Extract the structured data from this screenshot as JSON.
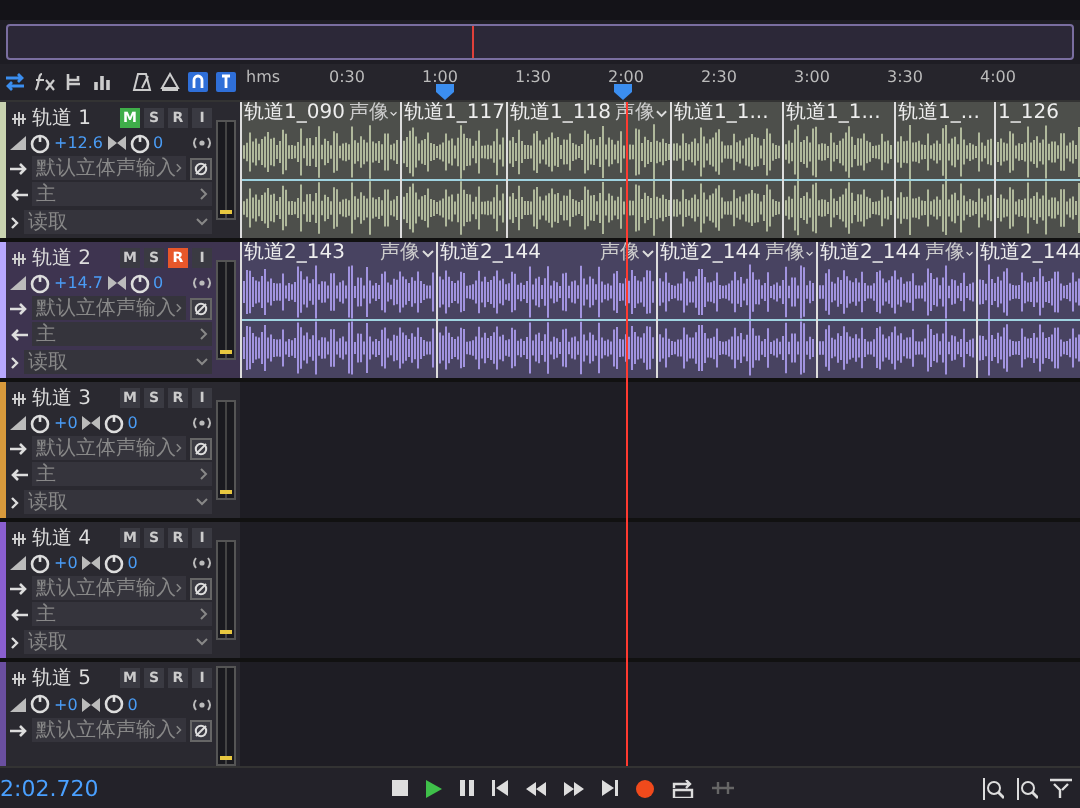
{
  "ruler": {
    "unit": "hms",
    "ticks": [
      "0:30",
      "1:00",
      "1:30",
      "2:00",
      "2:30",
      "3:00",
      "3:30",
      "4:00"
    ]
  },
  "tracks": [
    {
      "name": "轨道 1",
      "selected": false,
      "color": "#c9d3b0",
      "buttons": [
        {
          "label": "M",
          "on": true
        },
        {
          "label": "S",
          "on": false
        },
        {
          "label": "R",
          "on": false
        },
        {
          "label": "I",
          "on": false
        }
      ],
      "volume": "+12.6",
      "pan": "0",
      "input": "默认立体声输入",
      "output": "主",
      "automation": "读取",
      "clips": [
        {
          "name": "轨道1_090",
          "pan": "声像"
        },
        {
          "name": "轨道1_117"
        },
        {
          "name": "轨道1_118",
          "pan": "声像"
        },
        {
          "name": "轨道1_1..."
        },
        {
          "name": "轨道1_1..."
        },
        {
          "name": "轨道1_..."
        },
        {
          "name": "1_126"
        }
      ]
    },
    {
      "name": "轨道 2",
      "selected": true,
      "color": "#b8a8ff",
      "buttons": [
        {
          "label": "M",
          "on": false
        },
        {
          "label": "S",
          "on": false
        },
        {
          "label": "R",
          "on": true
        },
        {
          "label": "I",
          "on": false
        }
      ],
      "volume": "+14.7",
      "pan": "0",
      "input": "默认立体声输入",
      "output": "主",
      "automation": "读取",
      "clips": [
        {
          "name": "轨道2_143",
          "pan": "声像"
        },
        {
          "name": "轨道2_144",
          "pan": "声像"
        },
        {
          "name": "轨道2_144",
          "pan": "声像"
        },
        {
          "name": "轨道2_144",
          "pan": "声像"
        },
        {
          "name": "轨道2_144"
        }
      ]
    },
    {
      "name": "轨道 3",
      "selected": false,
      "color": "#d89a3c",
      "buttons": [
        {
          "label": "M",
          "on": false
        },
        {
          "label": "S",
          "on": false
        },
        {
          "label": "R",
          "on": false
        },
        {
          "label": "I",
          "on": false
        }
      ],
      "volume": "+0",
      "pan": "0",
      "input": "默认立体声输入",
      "output": "主",
      "automation": "读取"
    },
    {
      "name": "轨道 4",
      "selected": false,
      "color": "#8a5fd0",
      "buttons": [
        {
          "label": "M",
          "on": false
        },
        {
          "label": "S",
          "on": false
        },
        {
          "label": "R",
          "on": false
        },
        {
          "label": "I",
          "on": false
        }
      ],
      "volume": "+0",
      "pan": "0",
      "input": "默认立体声输入",
      "output": "主",
      "automation": "读取"
    },
    {
      "name": "轨道 5",
      "selected": false,
      "color": "#6a4fa0",
      "buttons": [
        {
          "label": "M",
          "on": false
        },
        {
          "label": "S",
          "on": false
        },
        {
          "label": "R",
          "on": false
        },
        {
          "label": "I",
          "on": false
        }
      ],
      "volume": "+0",
      "pan": "0",
      "input": "默认立体声输入"
    }
  ],
  "transport": {
    "time": "2:02.720"
  }
}
